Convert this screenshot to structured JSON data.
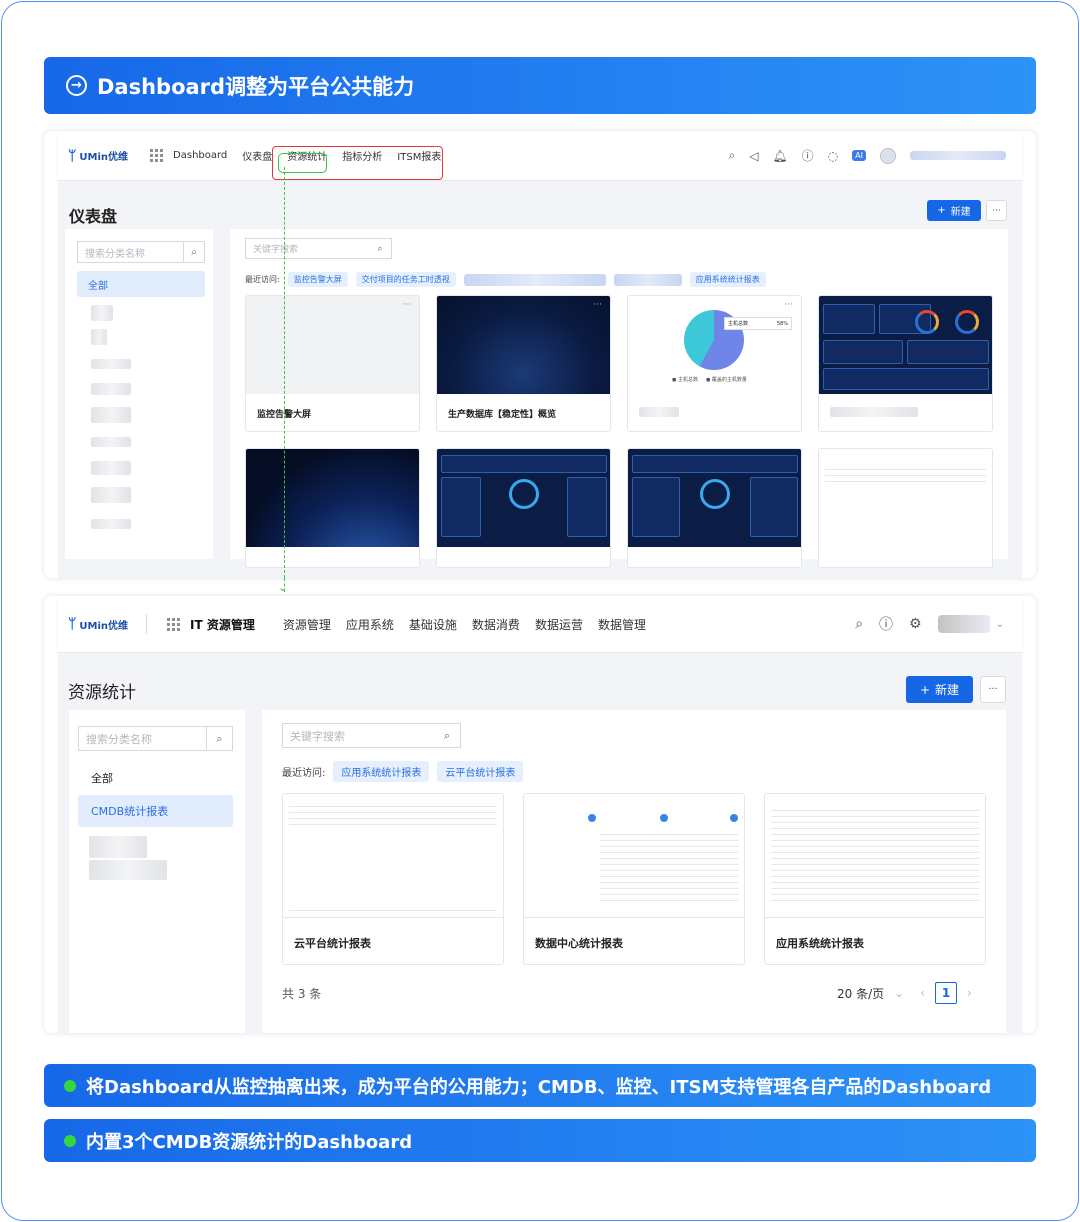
{
  "header_banner": {
    "title": "Dashboard调整为平台公共能力",
    "icon": "arrow-right-circle-icon"
  },
  "screen1": {
    "logo": "UMin优维",
    "nav": {
      "dashboard": "Dashboard",
      "items": [
        "仪表盘",
        "资源统计",
        "指标分析",
        "ITSM报表"
      ]
    },
    "page_title": "仪表盘",
    "new_button": "新建",
    "more_button": "···",
    "sidebar": {
      "search_placeholder": "搜索分类名称",
      "all_label": "全部"
    },
    "main": {
      "search_placeholder": "关键字搜索",
      "recent_label": "最近访问:",
      "recent_tags": [
        "监控告警大屏",
        "交付项目的任务工时透视",
        "应用系统统计报表"
      ],
      "cards": [
        {
          "title": "监控告警大屏"
        },
        {
          "title": "生产数据库【稳定性】概览"
        },
        {
          "title": ""
        },
        {
          "title": ""
        }
      ],
      "pie_chart": {
        "legend_top": "主机总数",
        "legend_percent": "58%",
        "legend_a": "主机总数",
        "legend_b": "覆盖的主机数量",
        "center_value": "00,123"
      }
    }
  },
  "screen2": {
    "logo": "UMin优维",
    "nav": {
      "product": "IT 资源管理",
      "items": [
        "资源管理",
        "应用系统",
        "基础设施",
        "数据消费",
        "数据运营",
        "数据管理"
      ]
    },
    "page_title": "资源统计",
    "new_button": "新建",
    "more_button": "···",
    "sidebar": {
      "search_placeholder": "搜索分类名称",
      "all_label": "全部",
      "selected_label": "CMDB统计报表"
    },
    "main": {
      "search_placeholder": "关键字搜索",
      "recent_label": "最近访问:",
      "recent_tags": [
        "应用系统统计报表",
        "云平台统计报表"
      ],
      "cards": [
        {
          "title": "云平台统计报表"
        },
        {
          "title": "数据中心统计报表"
        },
        {
          "title": "应用系统统计报表"
        }
      ],
      "total": "共 3 条",
      "page_size": "20 条/页",
      "current_page": "1"
    }
  },
  "notes": [
    "将Dashboard从监控抽离出来，成为平台的公用能力；CMDB、监控、ITSM支持管理各自产品的Dashboard",
    "内置3个CMDB资源统计的Dashboard"
  ],
  "colors": {
    "brand": "#1667e6",
    "banner_start": "#1768e8",
    "banner_end": "#2d93f7",
    "highlight_red": "#e23a3a",
    "highlight_green": "#35c443"
  }
}
